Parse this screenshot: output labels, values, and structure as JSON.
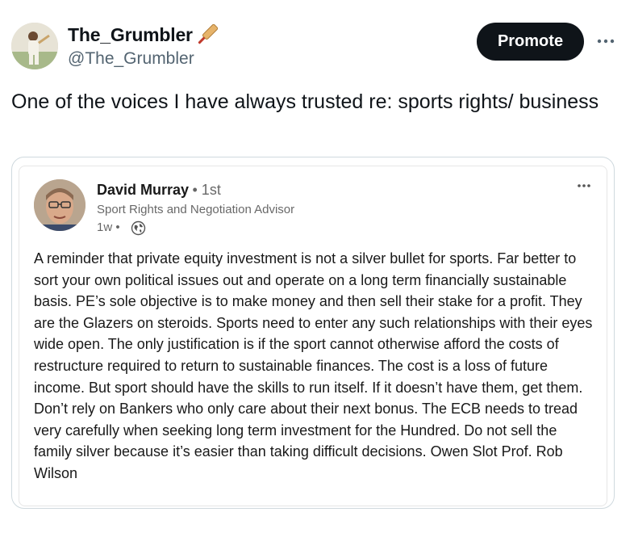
{
  "tweet": {
    "author": {
      "display_name": "The_Grumbler",
      "handle": "@The_Grumbler",
      "badge_icon": "cricket-bat-icon"
    },
    "promote_label": "Promote",
    "more_icon": "more-horizontal-icon",
    "text": "One of the voices I have always trusted re: sports rights/ business"
  },
  "quoted_post": {
    "author": {
      "name": "David Murray",
      "degree": "• 1st",
      "title": "Sport Rights and Negotiation Advisor"
    },
    "time": "1w •",
    "visibility_icon": "globe-icon",
    "more_icon": "more-horizontal-icon",
    "body": "A reminder that private equity investment is not a silver bullet for sports. Far better to sort your own political issues out and operate on a long term financially sustainable basis. PE’s sole objective is to make money and then sell their stake for a profit. They are the Glazers on steroids. Sports need to enter any such relationships with their eyes wide open. The only justification is if the sport cannot otherwise afford the costs of restructure required to return to sustainable finances. The cost is a loss of future income. But sport should have the skills to run itself. If it doesn’t have them, get them. Don’t rely on Bankers who only care about their next bonus. The ECB needs to tread very carefully when seeking long term investment for the Hundred. Do not sell the family silver because it’s easier than taking difficult decisions. Owen Slot Prof. Rob Wilson"
  },
  "colors": {
    "text_primary": "#0f1419",
    "text_secondary": "#536471",
    "button_bg": "#0f1419",
    "card_border": "#cfd9de"
  }
}
